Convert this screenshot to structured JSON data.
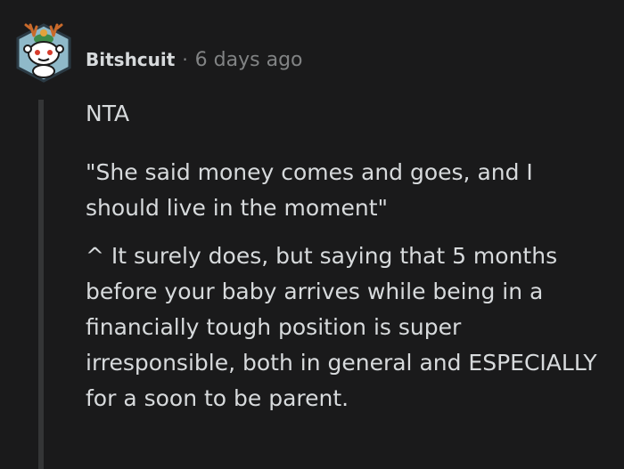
{
  "comment": {
    "author": "Bitshcuit",
    "separator": "·",
    "timestamp": "6 days ago",
    "paragraphs": [
      "NTA",
      "\"She said money comes and goes, and I should live in the moment\"",
      "^ It surely does, but saying that 5 months before your baby arrives while being in a financially tough position is super irresponsible, both in general and ESPECIALLY for a soon to be parent."
    ]
  },
  "colors": {
    "background": "#1a1a1b",
    "text": "#d7dadc",
    "meta": "#818384",
    "thread_line": "#343536",
    "avatar_bg": "#8fb9c9"
  },
  "icons": {
    "avatar": "snoo-avatar-icon"
  }
}
